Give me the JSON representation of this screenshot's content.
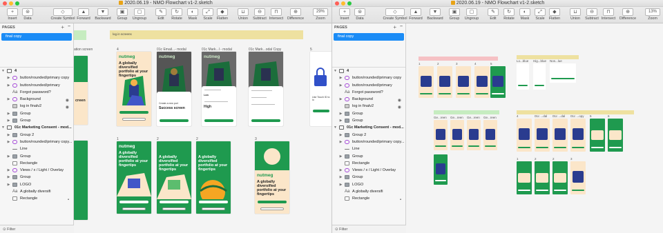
{
  "colors": {
    "selection": "#1b8cf6",
    "brand_green": "#1f9a4f",
    "peach": "#fbe6c9",
    "band_yellow": "#eee1a0",
    "band_pink": "#f6c1c4",
    "band_green": "#c6ecc0"
  },
  "left_window": {
    "title": "2020.06.19 - NMO Flowchart v1-2.sketch",
    "toolbar": {
      "insert": "Insert",
      "data": "Data",
      "create_symbol": "Create Symbol",
      "forward": "Forward",
      "backward": "Backward",
      "group": "Group",
      "ungroup": "Ungroup",
      "edit": "Edit",
      "rotate": "Rotate",
      "mask": "Mask",
      "scale": "Scale",
      "flatten": "Flatten",
      "union": "Union",
      "subtract": "Subtract",
      "intersect": "Intersect",
      "difference": "Difference",
      "zoom_value": "29%",
      "zoom": "Zoom"
    },
    "pages_header": "PAGES",
    "selected_page": "final copy",
    "layers": [
      {
        "name": "4",
        "icon": "artboard-icon",
        "caret": "▼",
        "indent": 0,
        "bold": true
      },
      {
        "name": "button/rounded/primary copy",
        "icon": "symbol-icon",
        "caret": "▶",
        "indent": 1
      },
      {
        "name": "button/rounded/primary",
        "icon": "symbol-icon",
        "caret": "▶",
        "indent": 1
      },
      {
        "name": "Forgot password?",
        "icon": "text-icon",
        "caret": "",
        "indent": 1
      },
      {
        "name": "Background",
        "icon": "symbol-icon",
        "caret": "▶",
        "indent": 1,
        "hidden": true
      },
      {
        "name": "log in finalv2",
        "icon": "image-icon",
        "caret": "",
        "indent": 1,
        "hidden": true
      },
      {
        "name": "Group",
        "icon": "folder-icon",
        "caret": "▶",
        "indent": 1
      },
      {
        "name": "Group",
        "icon": "folder-icon",
        "caret": "▶",
        "indent": 1
      },
      {
        "name": "01c Marketing Consent - mod...",
        "icon": "artboard-icon",
        "caret": "▼",
        "indent": 0,
        "bold": true
      },
      {
        "name": "Group 2",
        "icon": "folder-icon",
        "caret": "▶",
        "indent": 1
      },
      {
        "name": "button/rounded/primary copy...",
        "icon": "symbol-icon",
        "caret": "▶",
        "indent": 1
      },
      {
        "name": "Line",
        "icon": "line-icon",
        "caret": "",
        "indent": 1
      },
      {
        "name": "Group",
        "icon": "folder-icon",
        "caret": "▶",
        "indent": 1
      },
      {
        "name": "Rectangle",
        "icon": "rect-icon",
        "caret": "",
        "indent": 1
      },
      {
        "name": "Views / x / Light / Overlay",
        "icon": "symbol-icon",
        "caret": "▶",
        "indent": 1
      },
      {
        "name": "Group",
        "icon": "folder-icon",
        "caret": "▶",
        "indent": 1
      },
      {
        "name": "LOGO",
        "icon": "folder-icon",
        "caret": "▶",
        "indent": 1
      },
      {
        "name": "A globally diversifi",
        "icon": "text-icon",
        "caret": "",
        "indent": 1
      },
      {
        "name": "Rectangle",
        "icon": "rect-icon",
        "caret": "",
        "indent": 1,
        "locked": true
      }
    ],
    "filter_label": "Filter",
    "canvas": {
      "band_label": "log in screens",
      "partial_label": "ation screen",
      "partial_head": "creen",
      "artboard_labels": [
        "4",
        "01c Email...- modal",
        "01c Mark...l - modal",
        "01c Mark...odal Copy",
        "5",
        "1",
        "2",
        "2",
        "3"
      ],
      "brand": "nutmeg",
      "headline": "A globally diversified portfolio at your fingertips",
      "success_text": "Success screen",
      "success_small": "Create a new port",
      "modal_choice_a": "Low",
      "modal_choice_b": "High",
      "touch_id": "Use Touch ID to lo"
    }
  },
  "right_window": {
    "title": "2020.06.19 - NMO Flowchart v1-2.sketch",
    "zoom_value": "13%",
    "canvas": {
      "row1_labels": [
        "1",
        "2",
        "3",
        "4",
        "5"
      ],
      "row2_labels": [
        "Ge...reen",
        "Ge...reen",
        "Ge...reen",
        "Ge...reen"
      ],
      "row3_labels": [
        "4",
        "01c ...dal",
        "01c ...dal",
        "01c ...opy",
        "5",
        "6"
      ],
      "row4_labels": [
        "1",
        "2",
        "2",
        "3"
      ],
      "top_right_labels": [
        "Lo...blue",
        "Hig...blue",
        "Nos...lue"
      ],
      "brand": "nutmeg"
    }
  }
}
